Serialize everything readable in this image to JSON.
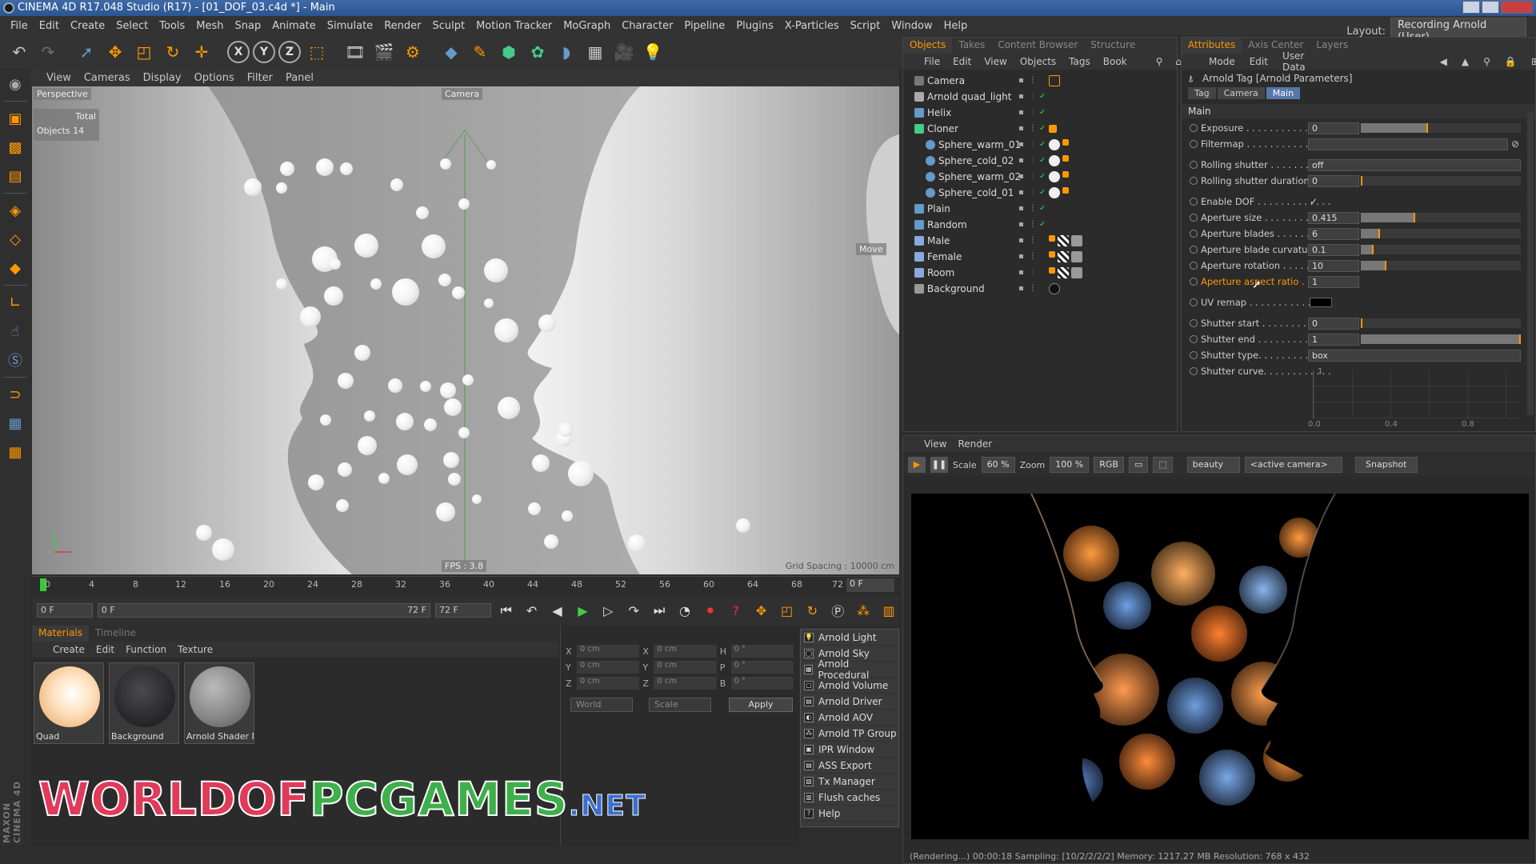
{
  "title": "CINEMA 4D R17.048 Studio (R17) - [01_DOF_03.c4d *] - Main",
  "menus": [
    "File",
    "Edit",
    "Create",
    "Select",
    "Tools",
    "Mesh",
    "Snap",
    "Animate",
    "Simulate",
    "Render",
    "Sculpt",
    "Motion Tracker",
    "MoGraph",
    "Character",
    "Pipeline",
    "Plugins",
    "X-Particles",
    "Script",
    "Window",
    "Help"
  ],
  "layout_label": "Layout:",
  "layout_value": "Recording Arnold (User)",
  "viewport": {
    "menus": [
      "View",
      "Cameras",
      "Display",
      "Options",
      "Filter",
      "Panel"
    ],
    "perspective": "Perspective",
    "camera_label": "Camera",
    "total": "Total",
    "objects_label": "Objects",
    "objects_count": "14",
    "move": "Move",
    "grid_spacing": "Grid Spacing : 10000 cm",
    "fps": "FPS : 3.8"
  },
  "timeline": {
    "ticks": [
      "0",
      "4",
      "8",
      "12",
      "16",
      "20",
      "24",
      "28",
      "32",
      "36",
      "40",
      "44",
      "48",
      "52",
      "56",
      "60",
      "64",
      "68",
      "72"
    ],
    "current_frame": "0 F"
  },
  "transport": {
    "start": "0 F",
    "range_start": "0 F",
    "range_end": "72 F",
    "end": "72 F"
  },
  "materials": {
    "tabs": [
      "Materials",
      "Timeline"
    ],
    "menu": [
      "Create",
      "Edit",
      "Function",
      "Texture"
    ],
    "items": [
      {
        "name": "Quad"
      },
      {
        "name": "Background"
      },
      {
        "name": "Arnold Shader N"
      }
    ]
  },
  "coords": {
    "rows": [
      {
        "a": "X",
        "av": "0 cm",
        "b": "X",
        "bv": "0 cm",
        "c": "H",
        "cv": "0 °"
      },
      {
        "a": "Y",
        "av": "0 cm",
        "b": "Y",
        "bv": "0 cm",
        "c": "P",
        "cv": "0 °"
      },
      {
        "a": "Z",
        "av": "0 cm",
        "b": "Z",
        "bv": "0 cm",
        "c": "B",
        "cv": "0 °"
      }
    ],
    "world": "World",
    "scale": "Scale",
    "apply": "Apply"
  },
  "arnold_menu": [
    "Arnold Light",
    "Arnold Sky",
    "Arnold Procedural",
    "Arnold Volume",
    "Arnold Driver",
    "Arnold AOV",
    "Arnold TP Group",
    "IPR Window",
    "ASS Export",
    "Tx Manager",
    "Flush caches",
    "Help"
  ],
  "watermark": {
    "w": "WORLD",
    "o": "OF",
    "p": "PCGAMES",
    "n": ".NET"
  },
  "maxon": "MAXON CINEMA 4D",
  "objects": {
    "tabs": [
      "Objects",
      "Takes",
      "Content Browser",
      "Structure"
    ],
    "menu": [
      "File",
      "Edit",
      "View",
      "Objects",
      "Tags",
      "Book"
    ],
    "items": [
      {
        "name": "Camera",
        "indent": 0
      },
      {
        "name": "Arnold quad_light",
        "indent": 0
      },
      {
        "name": "Helix",
        "indent": 0
      },
      {
        "name": "Cloner",
        "indent": 0
      },
      {
        "name": "Sphere_warm_01",
        "indent": 1
      },
      {
        "name": "Sphere_cold_02",
        "indent": 1
      },
      {
        "name": "Sphere_warm_02",
        "indent": 1
      },
      {
        "name": "Sphere_cold_01",
        "indent": 1
      },
      {
        "name": "Plain",
        "indent": 0
      },
      {
        "name": "Random",
        "indent": 0
      },
      {
        "name": "Male",
        "indent": 0
      },
      {
        "name": "Female",
        "indent": 0
      },
      {
        "name": "Room",
        "indent": 0
      },
      {
        "name": "Background",
        "indent": 0
      }
    ]
  },
  "attributes": {
    "tabs": [
      "Attributes",
      "Axis Center",
      "Layers"
    ],
    "menu": [
      "Mode",
      "Edit",
      "User Data"
    ],
    "tag_title": "Arnold Tag [Arnold Parameters]",
    "subtabs": [
      "Tag",
      "Camera",
      "Main"
    ],
    "section": "Main",
    "params": [
      {
        "label": "Exposure . . . . . . . . . . . . . .",
        "value": "0",
        "fill": 0.42
      },
      {
        "label": "Filtermap . . . . . . . . . . . . . .",
        "value": ""
      },
      {
        "label": "Rolling shutter . . . . . . . . . . .",
        "select": "off"
      },
      {
        "label": "Rolling shutter duration",
        "value": "0",
        "fill": 0.0
      },
      {
        "label": "Enable DOF . . . . . . . . . . . . .",
        "check": "✓"
      },
      {
        "label": "Aperture size . . . . . . . . . . .",
        "value": "0.415",
        "fill": 0.34
      },
      {
        "label": "Aperture blades . . . . . . . . . .",
        "value": "6",
        "fill": 0.12
      },
      {
        "label": "Aperture blade curvature",
        "value": "0.1",
        "fill": 0.08
      },
      {
        "label": "Aperture rotation . . . . . . . .",
        "value": "10",
        "fill": 0.16
      },
      {
        "label": "Aperture aspect ratio . . .",
        "value": "1"
      },
      {
        "label": "UV remap . . . . . . . . . . . . . .",
        "swatch": true
      },
      {
        "label": "Shutter start . . . . . . . . . . . .",
        "value": "0",
        "fill": 0.0
      },
      {
        "label": "Shutter end . . . . . . . . . . . . .",
        "value": "1",
        "fill": 1.0
      },
      {
        "label": "Shutter type. . . . . . . . . . . . .",
        "select": "box"
      },
      {
        "label": "Shutter curve. . . . . . . . . . . .",
        "value": ""
      }
    ],
    "curve_ticks": [
      "0.0",
      "0.4",
      "0.8"
    ],
    "curve_value": "1"
  },
  "render": {
    "menu": [
      "View",
      "Render"
    ],
    "scale_label": "Scale",
    "scale_value": "60 %",
    "zoom_label": "Zoom",
    "zoom_value": "100 %",
    "rgb": "RGB",
    "aov": "beauty",
    "camera": "<active camera>",
    "snapshot": "Snapshot",
    "status": "(Rendering...) 00:00:18  Sampling: [10/2/2/2/2]  Memory: 1217.27 MB  Resolution: 768 x 432"
  },
  "colors": {
    "accent": "#ff9900",
    "selected_tab": "#5577aa"
  }
}
